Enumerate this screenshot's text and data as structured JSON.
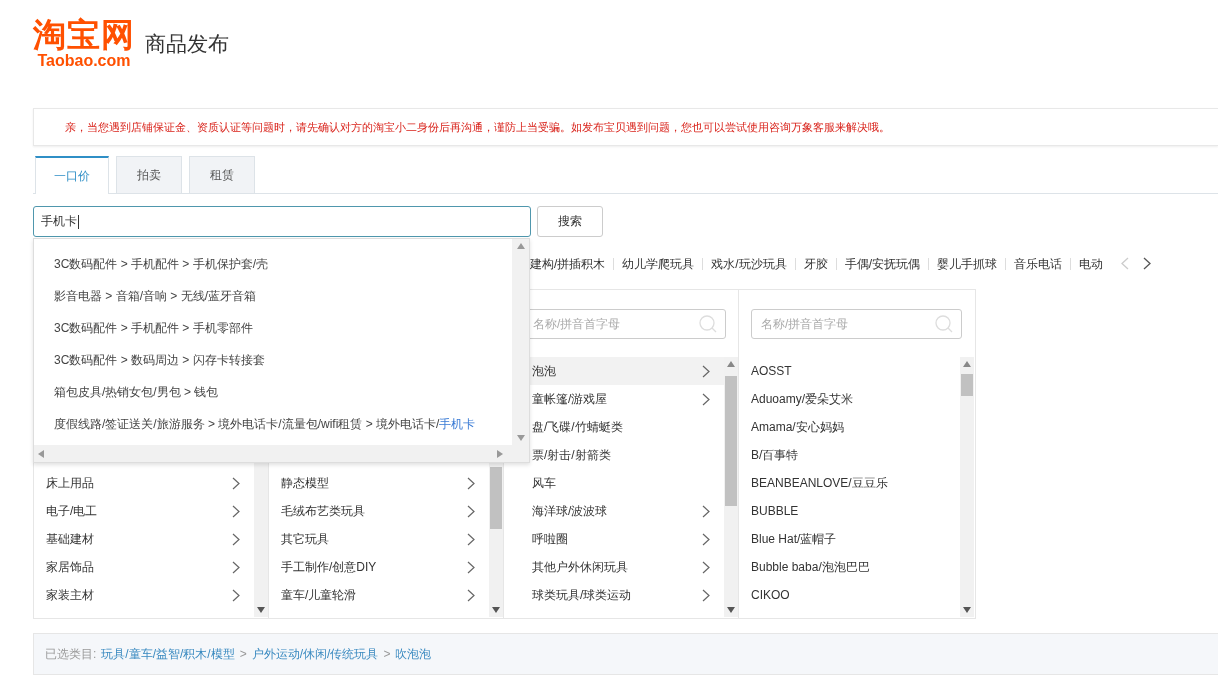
{
  "header": {
    "logo_cn": "淘宝网",
    "logo_en": "Taobao.com",
    "title": "商品发布"
  },
  "notice": "亲，当您遇到店铺保证金、资质认证等问题时，请先确认对方的淘宝小二身份后再沟通，谨防上当受骗。如发布宝贝遇到问题，您也可以尝试使用咨询万象客服来解决哦。",
  "tabs": [
    {
      "label": "一口价",
      "selected": true
    },
    {
      "label": "拍卖",
      "selected": false
    },
    {
      "label": "租赁",
      "selected": false
    }
  ],
  "search": {
    "value": "手机卡",
    "button": "搜索"
  },
  "suggestions": [
    {
      "path": "3C数码配件 > 手机配件 > 手机保护套/壳"
    },
    {
      "path": "影音电器 > 音箱/音响 > 无线/蓝牙音箱"
    },
    {
      "path": "3C数码配件 > 手机配件 > 手机零部件"
    },
    {
      "path": "3C数码配件 > 数码周边 > 闪存卡转接套"
    },
    {
      "path": "箱包皮具/热销女包/男包 > 钱包"
    },
    {
      "path": "度假线路/签证送关/旅游服务 > 境外电话卡/流量包/wifi租赁 > 境外电话卡/",
      "match": "手机卡"
    }
  ],
  "quick_categories": [
    "建构/拼插积木",
    "幼儿学爬玩具",
    "戏水/玩沙玩具",
    "牙胶",
    "手偶/安抚玩偶",
    "婴儿手抓球",
    "音乐电话",
    "电动"
  ],
  "columns": [
    {
      "items": [
        {
          "label": "床上用品",
          "has_children": true,
          "selected": false
        },
        {
          "label": "电子/电工",
          "has_children": true,
          "selected": false
        },
        {
          "label": "基础建材",
          "has_children": true,
          "selected": false
        },
        {
          "label": "家居饰品",
          "has_children": true,
          "selected": false
        },
        {
          "label": "家装主材",
          "has_children": true,
          "selected": false
        }
      ]
    },
    {
      "items": [
        {
          "label": "静态模型",
          "has_children": true,
          "selected": false
        },
        {
          "label": "毛绒布艺类玩具",
          "has_children": true,
          "selected": false
        },
        {
          "label": "其它玩具",
          "has_children": true,
          "selected": false
        },
        {
          "label": "手工制作/创意DIY",
          "has_children": true,
          "selected": false
        },
        {
          "label": "童车/儿童轮滑",
          "has_children": true,
          "selected": false
        }
      ]
    },
    {
      "placeholder": "名称/拼音首字母",
      "items": [
        {
          "label": "泡泡",
          "has_children": true,
          "selected": true
        },
        {
          "label": "童帐篷/游戏屋",
          "has_children": true,
          "selected": false
        },
        {
          "label": "盘/飞碟/竹蜻蜓类",
          "has_children": false,
          "selected": false
        },
        {
          "label": "票/射击/射箭类",
          "has_children": false,
          "selected": false
        },
        {
          "label": "风车",
          "has_children": false,
          "selected": false
        },
        {
          "label": "海洋球/波波球",
          "has_children": true,
          "selected": false
        },
        {
          "label": "呼啦圈",
          "has_children": true,
          "selected": false
        },
        {
          "label": "其他户外休闲玩具",
          "has_children": true,
          "selected": false
        },
        {
          "label": "球类玩具/球类运动",
          "has_children": true,
          "selected": false
        }
      ]
    },
    {
      "placeholder": "名称/拼音首字母",
      "items": [
        {
          "label": "AOSST",
          "has_children": false,
          "selected": false
        },
        {
          "label": "Aduoamy/爱朵艾米",
          "has_children": false,
          "selected": false
        },
        {
          "label": "Amama/安心妈妈",
          "has_children": false,
          "selected": false
        },
        {
          "label": "B/百事特",
          "has_children": false,
          "selected": false
        },
        {
          "label": "BEANBEANLOVE/豆豆乐",
          "has_children": false,
          "selected": false
        },
        {
          "label": "BUBBLE",
          "has_children": false,
          "selected": false
        },
        {
          "label": "Blue Hat/蓝帽子",
          "has_children": false,
          "selected": false
        },
        {
          "label": "Bubble baba/泡泡巴巴",
          "has_children": false,
          "selected": false
        },
        {
          "label": "CIKOO",
          "has_children": false,
          "selected": false
        }
      ]
    }
  ],
  "selected_path": {
    "label": "已选类目:",
    "separator": ">",
    "parts": [
      "玩具/童车/益智/积木/模型",
      "户外运动/休闲/传统玩具",
      "吹泡泡"
    ]
  }
}
